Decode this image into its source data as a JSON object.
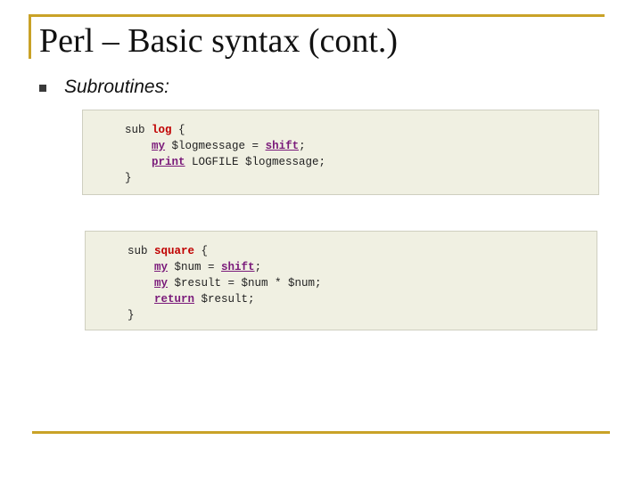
{
  "slide": {
    "title": "Perl – Basic syntax (cont.)",
    "bullet": "Subroutines:",
    "colors": {
      "accent_rule": "#c9a227",
      "code_background": "#f0f0e2",
      "keyword": "#7a1a7a",
      "function_name": "#c00000"
    }
  },
  "code_blocks": [
    {
      "lines": [
        [
          {
            "t": "sub ",
            "c": "plain"
          },
          {
            "t": "log",
            "c": "fn"
          },
          {
            "t": " {",
            "c": "plain"
          }
        ],
        [
          {
            "t": "    ",
            "c": "plain"
          },
          {
            "t": "my",
            "c": "kw"
          },
          {
            "t": " $logmessage = ",
            "c": "plain"
          },
          {
            "t": "shift",
            "c": "kw"
          },
          {
            "t": ";",
            "c": "plain"
          }
        ],
        [
          {
            "t": "    ",
            "c": "plain"
          },
          {
            "t": "print",
            "c": "kw"
          },
          {
            "t": " LOGFILE $logmessage;",
            "c": "plain"
          }
        ],
        [
          {
            "t": "}",
            "c": "plain"
          }
        ]
      ]
    },
    {
      "lines": [
        [
          {
            "t": "sub ",
            "c": "plain"
          },
          {
            "t": "square",
            "c": "fn"
          },
          {
            "t": " {",
            "c": "plain"
          }
        ],
        [
          {
            "t": "    ",
            "c": "plain"
          },
          {
            "t": "my",
            "c": "kw"
          },
          {
            "t": " $num = ",
            "c": "plain"
          },
          {
            "t": "shift",
            "c": "kw"
          },
          {
            "t": ";",
            "c": "plain"
          }
        ],
        [
          {
            "t": "    ",
            "c": "plain"
          },
          {
            "t": "my",
            "c": "kw"
          },
          {
            "t": " $result = $num * $num;",
            "c": "plain"
          }
        ],
        [
          {
            "t": "    ",
            "c": "plain"
          },
          {
            "t": "return",
            "c": "kw"
          },
          {
            "t": " $result;",
            "c": "plain"
          }
        ],
        [
          {
            "t": "}",
            "c": "plain"
          }
        ]
      ]
    }
  ]
}
